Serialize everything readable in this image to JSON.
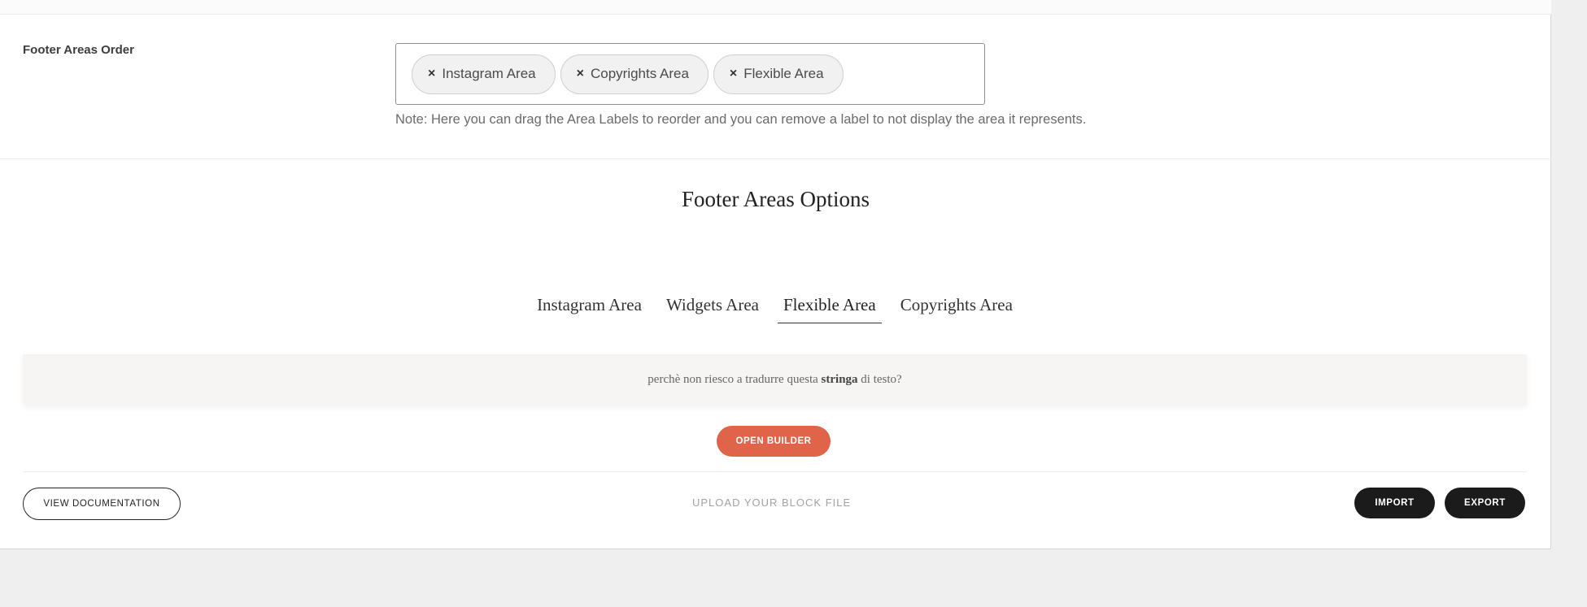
{
  "footer_order": {
    "label": "Footer Areas Order",
    "tags": [
      {
        "remove": "×",
        "label": "Instagram Area"
      },
      {
        "remove": "×",
        "label": "Copyrights Area"
      },
      {
        "remove": "×",
        "label": "Flexible Area"
      }
    ],
    "note": "Note: Here you can drag the Area Labels to reorder and you can remove a label to not display the area it represents."
  },
  "options": {
    "title": "Footer Areas Options",
    "tabs": [
      {
        "label": "Instagram Area",
        "active": false
      },
      {
        "label": "Widgets Area",
        "active": false
      },
      {
        "label": "Flexible Area",
        "active": true
      },
      {
        "label": "Copyrights Area",
        "active": false
      }
    ],
    "info": {
      "before": "perchè non riesco a tradurre questa ",
      "bold": "stringa",
      "after": " di testo?"
    },
    "open_builder": "OPEN BUILDER"
  },
  "footer_bar": {
    "documentation": "VIEW DOCUMENTATION",
    "upload": "UPLOAD YOUR BLOCK FILE",
    "import": "IMPORT",
    "export": "EXPORT"
  },
  "colors": {
    "accent": "#e0644a",
    "dark_button": "#1b1b1b",
    "page_bg": "#efeff0"
  }
}
